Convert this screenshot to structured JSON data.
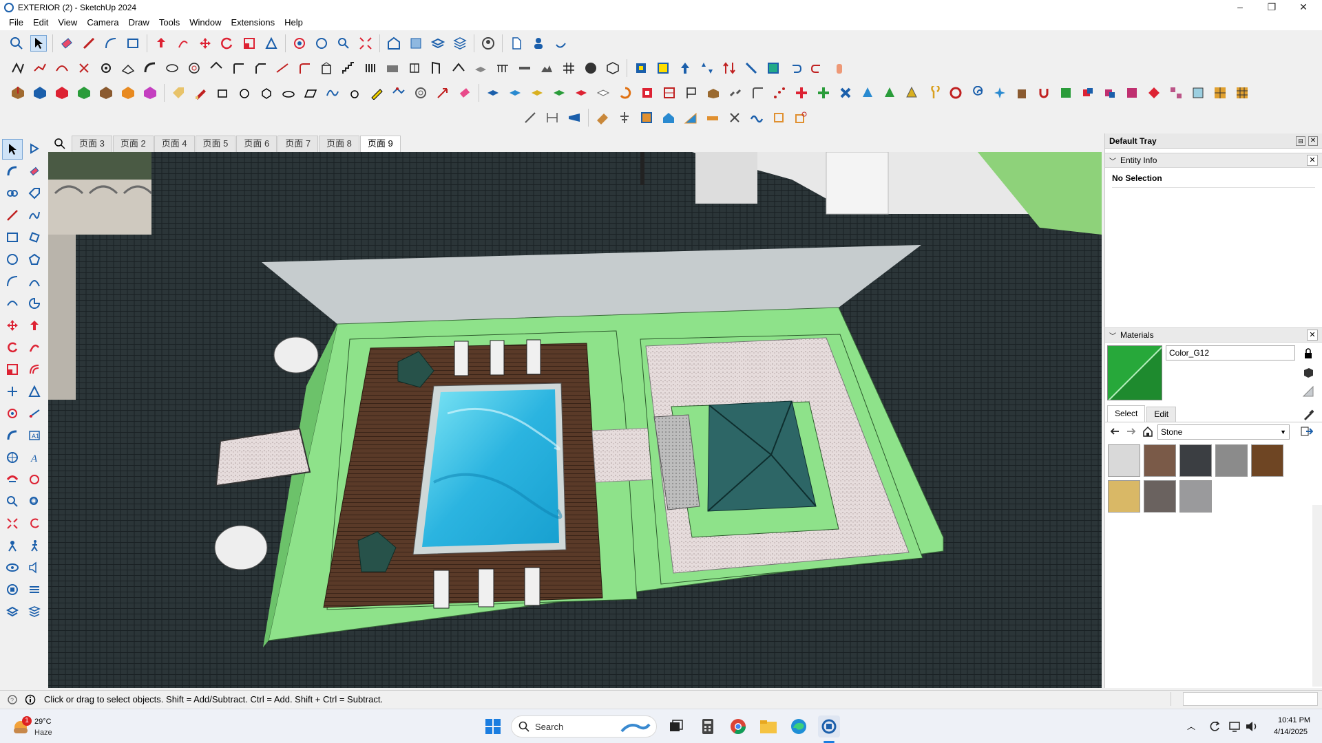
{
  "window": {
    "title": "EXTERIOR  (2) - SketchUp 2024",
    "minimize_glyph": "–",
    "maximize_glyph": "❐",
    "close_glyph": "✕"
  },
  "menu": [
    "File",
    "Edit",
    "View",
    "Camera",
    "Draw",
    "Tools",
    "Window",
    "Extensions",
    "Help"
  ],
  "scenes": {
    "tabs": [
      "页面 3",
      "页面 2",
      "页面 4",
      "页面 5",
      "页面 6",
      "页面 7",
      "页面 8",
      "页面 9"
    ],
    "active": "页面 9"
  },
  "tray": {
    "title": "Default Tray",
    "entity_info": {
      "title": "Entity Info",
      "selection": "No Selection"
    },
    "materials": {
      "title": "Materials",
      "current_material": "Color_G12",
      "current_color": "#27a83a",
      "tabs": [
        "Select",
        "Edit"
      ],
      "active_tab": "Select",
      "library": "Stone",
      "swatch_colors": [
        "#d9d9d9",
        "#7a5a48",
        "#3b3e42",
        "#8b8b8b",
        "#6e4523",
        "#d9b866",
        "#6a625f",
        "#9a9a9c"
      ]
    }
  },
  "status": {
    "hint": "Click or drag to select objects. Shift = Add/Subtract. Ctrl = Add. Shift + Ctrl = Subtract."
  },
  "taskbar": {
    "weather_temp": "29°C",
    "weather_desc": "Haze",
    "weather_badge": "1",
    "search_placeholder": "Search",
    "time": "10:41 PM",
    "date": "4/14/2025"
  },
  "colors": {
    "roof": "#2b3538",
    "lawn": "#8ee28a",
    "deck": "#5a3a28",
    "pool": "#46c8e6",
    "accent": "#1b5fab"
  }
}
